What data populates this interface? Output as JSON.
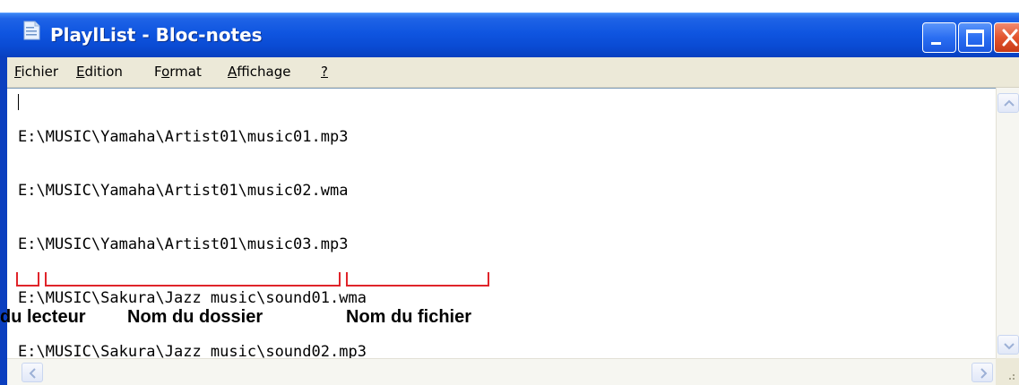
{
  "window": {
    "title": "PlaylList - Bloc-notes"
  },
  "menu": {
    "items": [
      {
        "accel": "F",
        "rest": "ichier"
      },
      {
        "accel": "E",
        "rest": "dition"
      },
      {
        "pre": "F",
        "accel": "o",
        "rest": "rmat"
      },
      {
        "accel": "A",
        "rest": "ffichage"
      },
      {
        "accel": "?",
        "rest": ""
      }
    ]
  },
  "editor": {
    "lines": [
      "E:\\MUSIC\\Yamaha\\Artist01\\music01.mp3",
      "E:\\MUSIC\\Yamaha\\Artist01\\music02.wma",
      "E:\\MUSIC\\Yamaha\\Artist01\\music03.mp3",
      "E:\\MUSIC\\Sakura\\Jazz music\\sound01.wma",
      "E:\\MUSIC\\Sakura\\Jazz music\\sound02.mp3"
    ]
  },
  "annotations": {
    "drive_label": "du lecteur",
    "folder_label": "Nom du dossier",
    "file_label": "Nom du fichier",
    "bracket_color": "#e0242a"
  },
  "icons": {
    "app": "notepad-icon",
    "minimize": "minimize-icon",
    "maximize": "maximize-icon",
    "close": "close-icon",
    "scroll_up": "chevron-up-icon",
    "scroll_down": "chevron-down-icon",
    "scroll_left": "chevron-left-icon",
    "scroll_right": "chevron-right-icon"
  }
}
